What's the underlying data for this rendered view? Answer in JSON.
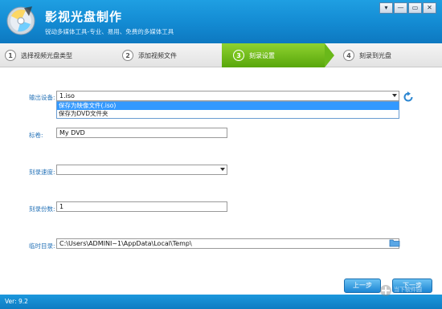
{
  "app": {
    "title": "影视光盘制作",
    "subtitle": "锐动多媒体工具-专业、易用、免费的多媒体工具",
    "window_buttons": [
      "▾",
      "—",
      "▭",
      "✕"
    ]
  },
  "steps": [
    {
      "num": "1",
      "label": "选择视频光盘类型",
      "active": false
    },
    {
      "num": "2",
      "label": "添加视频文件",
      "active": false
    },
    {
      "num": "3",
      "label": "刻录设置",
      "active": true
    },
    {
      "num": "4",
      "label": "刻录到光盘",
      "active": false
    }
  ],
  "form": {
    "output_device": {
      "label": "输出设备:",
      "value": "1.iso",
      "options": [
        "保存为映像文件(.iso)",
        "保存为DVD文件夹"
      ],
      "highlighted_index": 0
    },
    "volume_label": {
      "label": "标卷:",
      "value": "My DVD"
    },
    "burn_speed": {
      "label": "刻录速度:",
      "value": ""
    },
    "copies": {
      "label": "刻录份数:",
      "value": "1"
    },
    "temp_dir": {
      "label": "临时目录:",
      "value": "C:\\Users\\ADMINI~1\\AppData\\Local\\Temp\\"
    }
  },
  "buttons": {
    "prev": "上一步",
    "next": "下一步"
  },
  "status": {
    "version": "Ver: 9.2"
  },
  "watermark": {
    "text": "当下软件园"
  },
  "colors": {
    "title_bar": "#138ad2",
    "active_step": "#6ab81a",
    "label_blue": "#2874b8",
    "button_blue": "#1c86d4"
  },
  "icons": [
    "disc-logo-icon",
    "refresh-icon",
    "folder-icon",
    "dropdown-arrow-icon"
  ]
}
